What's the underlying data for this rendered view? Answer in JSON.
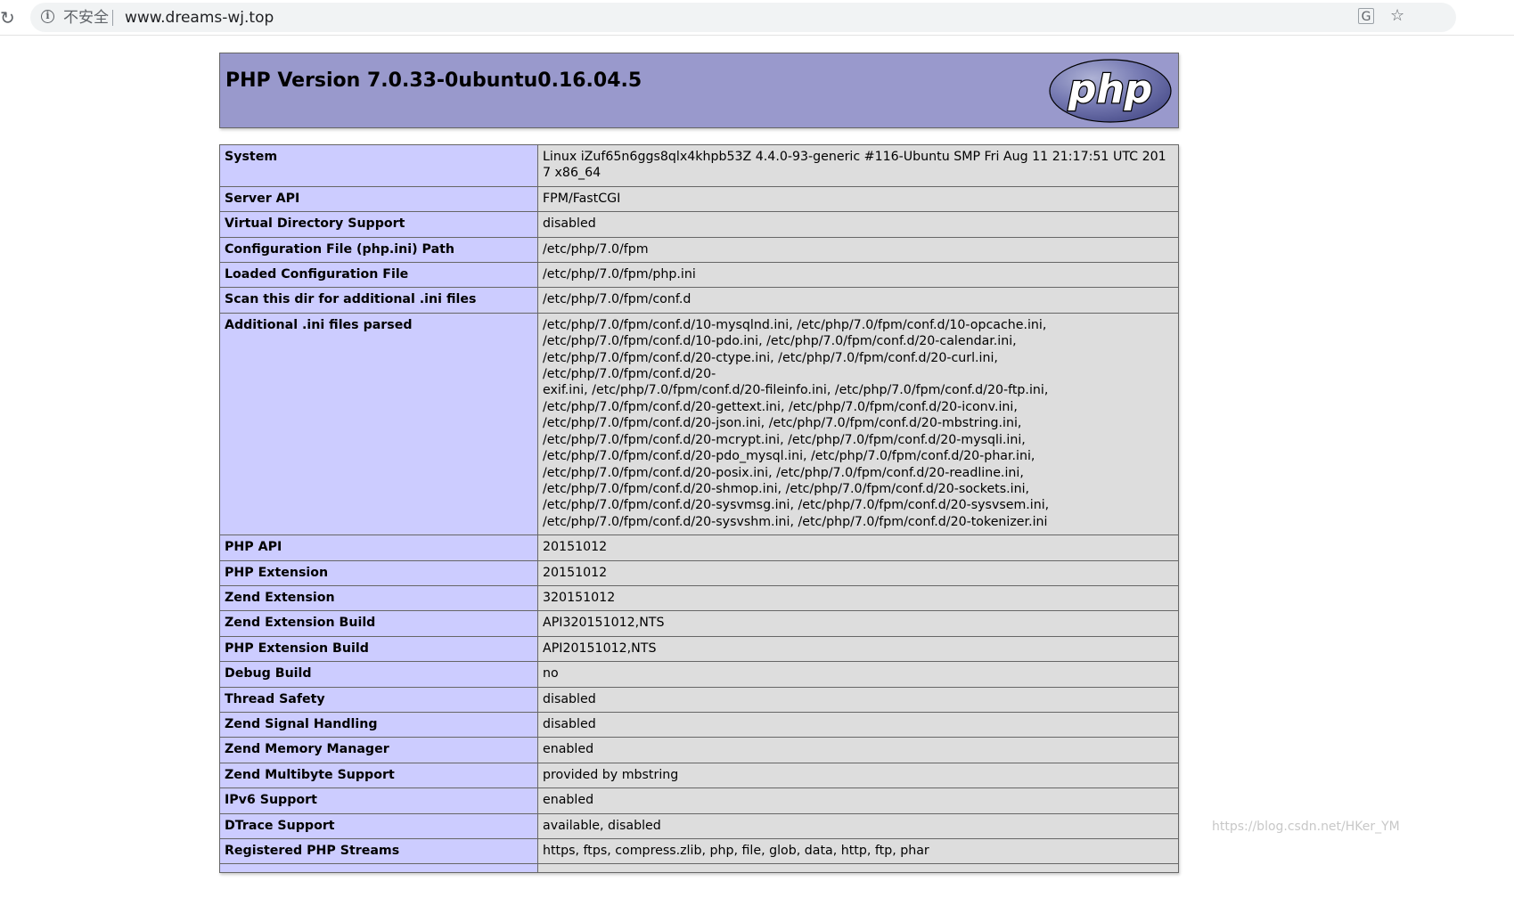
{
  "browser": {
    "reload_icon": "reload-icon",
    "insecure_label": "不安全",
    "url": "www.dreams-wj.top",
    "translate_icon": "translate-icon",
    "bookmark_icon": "star-icon"
  },
  "header": {
    "title": "PHP Version 7.0.33-0ubuntu0.16.04.5",
    "logo_text": "php",
    "bg_color": "#9999cc"
  },
  "rows": [
    {
      "key": "System",
      "value": "Linux iZuf65n6ggs8qlx4khpb53Z 4.4.0-93-generic #116-Ubuntu SMP Fri Aug 11 21:17:51 UTC 2017 x86_64"
    },
    {
      "key": "Server API",
      "value": "FPM/FastCGI"
    },
    {
      "key": "Virtual Directory Support",
      "value": "disabled"
    },
    {
      "key": "Configuration File (php.ini) Path",
      "value": "/etc/php/7.0/fpm"
    },
    {
      "key": "Loaded Configuration File",
      "value": "/etc/php/7.0/fpm/php.ini"
    },
    {
      "key": "Scan this dir for additional .ini files",
      "value": "/etc/php/7.0/fpm/conf.d"
    },
    {
      "key": "Additional .ini files parsed",
      "value": "/etc/php/7.0/fpm/conf.d/10-mysqlnd.ini, /etc/php/7.0/fpm/conf.d/10-opcache.ini,\n/etc/php/7.0/fpm/conf.d/10-pdo.ini, /etc/php/7.0/fpm/conf.d/20-calendar.ini,\n/etc/php/7.0/fpm/conf.d/20-ctype.ini, /etc/php/7.0/fpm/conf.d/20-curl.ini, /etc/php/7.0/fpm/conf.d/20-\nexif.ini, /etc/php/7.0/fpm/conf.d/20-fileinfo.ini, /etc/php/7.0/fpm/conf.d/20-ftp.ini,\n/etc/php/7.0/fpm/conf.d/20-gettext.ini, /etc/php/7.0/fpm/conf.d/20-iconv.ini,\n/etc/php/7.0/fpm/conf.d/20-json.ini, /etc/php/7.0/fpm/conf.d/20-mbstring.ini,\n/etc/php/7.0/fpm/conf.d/20-mcrypt.ini, /etc/php/7.0/fpm/conf.d/20-mysqli.ini,\n/etc/php/7.0/fpm/conf.d/20-pdo_mysql.ini, /etc/php/7.0/fpm/conf.d/20-phar.ini,\n/etc/php/7.0/fpm/conf.d/20-posix.ini, /etc/php/7.0/fpm/conf.d/20-readline.ini,\n/etc/php/7.0/fpm/conf.d/20-shmop.ini, /etc/php/7.0/fpm/conf.d/20-sockets.ini,\n/etc/php/7.0/fpm/conf.d/20-sysvmsg.ini, /etc/php/7.0/fpm/conf.d/20-sysvsem.ini,\n/etc/php/7.0/fpm/conf.d/20-sysvshm.ini, /etc/php/7.0/fpm/conf.d/20-tokenizer.ini"
    },
    {
      "key": "PHP API",
      "value": "20151012"
    },
    {
      "key": "PHP Extension",
      "value": "20151012"
    },
    {
      "key": "Zend Extension",
      "value": "320151012"
    },
    {
      "key": "Zend Extension Build",
      "value": "API320151012,NTS"
    },
    {
      "key": "PHP Extension Build",
      "value": "API20151012,NTS"
    },
    {
      "key": "Debug Build",
      "value": "no"
    },
    {
      "key": "Thread Safety",
      "value": "disabled"
    },
    {
      "key": "Zend Signal Handling",
      "value": "disabled"
    },
    {
      "key": "Zend Memory Manager",
      "value": "enabled"
    },
    {
      "key": "Zend Multibyte Support",
      "value": "provided by mbstring"
    },
    {
      "key": "IPv6 Support",
      "value": "enabled"
    },
    {
      "key": "DTrace Support",
      "value": "available, disabled"
    },
    {
      "key": "Registered PHP Streams",
      "value": "https, ftps, compress.zlib, php, file, glob, data, http, ftp, phar"
    },
    {
      "key": "",
      "value": ""
    }
  ],
  "colors": {
    "key_cell": "#ccccff",
    "value_cell": "#dddddd",
    "border": "#666666"
  },
  "watermark": "https://blog.csdn.net/HKer_YM"
}
